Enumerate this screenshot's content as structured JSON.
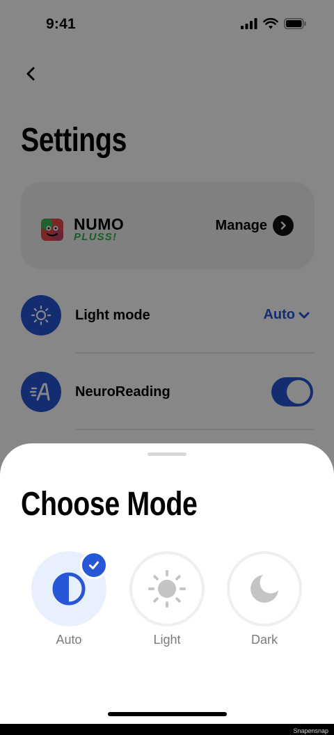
{
  "status_bar": {
    "time": "9:41"
  },
  "header": {
    "title": "Settings",
    "back_icon": "chevron-left-icon"
  },
  "subscription": {
    "brand_word": "NUMO",
    "brand_sub": "PLUSS!",
    "manage_label": "Manage",
    "manage_icon": "chevron-right-circle-icon"
  },
  "settings": {
    "light_mode": {
      "label": "Light mode",
      "value": "Auto",
      "icon": "sun-icon"
    },
    "neuro_reading": {
      "label": "NeuroReading",
      "enabled": true,
      "icon": "neuro-reading-icon"
    }
  },
  "sheet": {
    "title": "Choose Mode",
    "options": [
      {
        "label": "Auto",
        "icon": "half-circle-icon",
        "selected": true
      },
      {
        "label": "Light",
        "icon": "sun-icon",
        "selected": false
      },
      {
        "label": "Dark",
        "icon": "moon-icon",
        "selected": false
      }
    ]
  },
  "colors": {
    "accent": "#2756d6",
    "brand_green": "#2bb34a",
    "selected_bg": "#e8f0fd"
  },
  "watermark": "Snapensnap"
}
